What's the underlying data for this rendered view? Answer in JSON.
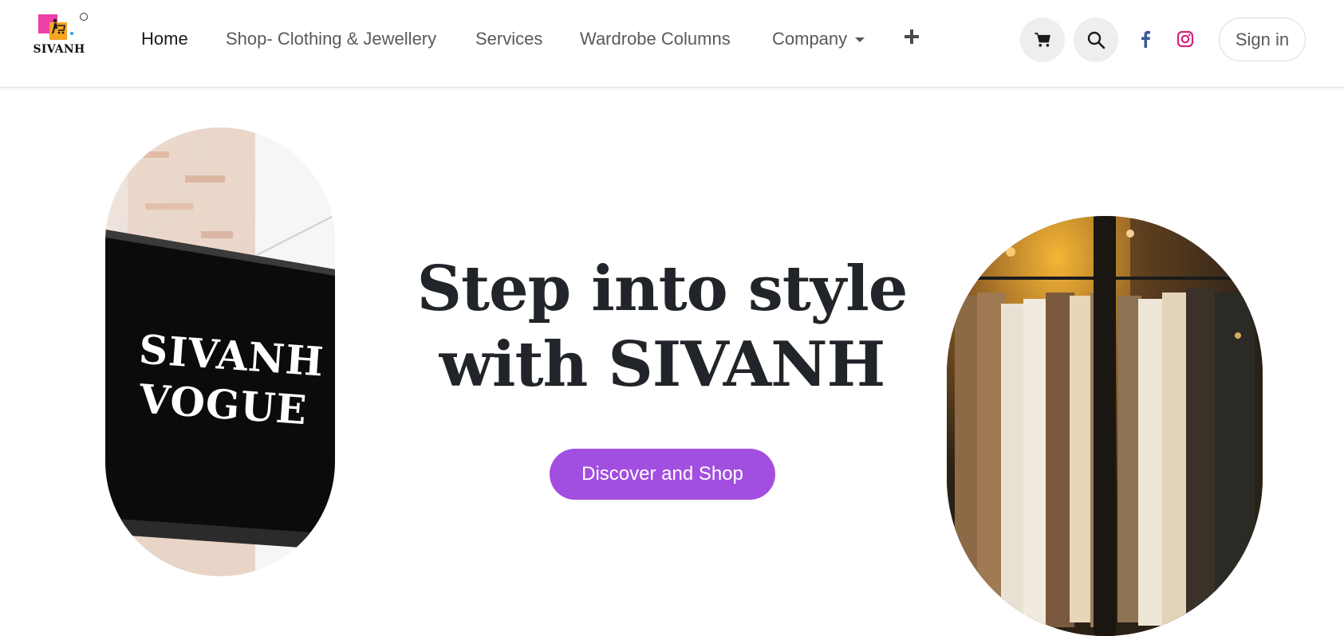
{
  "brand": {
    "name": "SIVANH",
    "logo_icon": "shopping-cart-person-logo",
    "colors": {
      "pink": "#ee3fa4",
      "orange": "#f5a623",
      "blue": "#1fa3e0"
    }
  },
  "nav": {
    "items": [
      {
        "label": "Home",
        "active": true
      },
      {
        "label": "Shop- Clothing & Jewellery",
        "active": false
      },
      {
        "label": "Services",
        "active": false
      },
      {
        "label": "Wardrobe Columns",
        "active": false
      },
      {
        "label": "Company",
        "active": false,
        "dropdown": true
      }
    ],
    "add_icon": "plus-icon"
  },
  "actions": {
    "cart_icon": "shopping-cart-icon",
    "search_icon": "search-icon",
    "facebook_icon": "facebook-icon",
    "instagram_icon": "instagram-icon",
    "signin_label": "Sign in"
  },
  "hero": {
    "headline_line1": "Step into style",
    "headline_line2": "with SIVANH",
    "cta_label": "Discover and Shop",
    "cta_color": "#a24ee0",
    "left_image": {
      "sign_line1": "SIVANH",
      "sign_line2": "VOGUE"
    },
    "right_image": {
      "subject": "clothing rack in boutique window"
    }
  }
}
